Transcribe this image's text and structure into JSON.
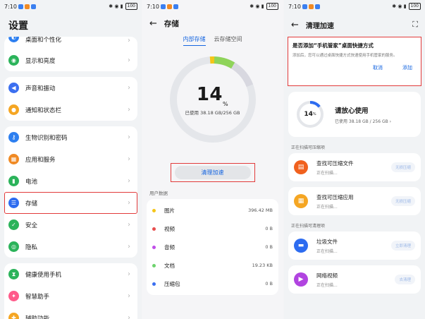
{
  "status": {
    "time": "7:10",
    "battery": "100"
  },
  "settings": {
    "title": "设置",
    "groups": [
      [
        {
          "label": "桌面和个性化",
          "icon": "palette-icon",
          "color": "#2d7ff0"
        },
        {
          "label": "显示和亮度",
          "icon": "eye-icon",
          "color": "#2bb35a"
        }
      ],
      [
        {
          "label": "声音和振动",
          "icon": "speaker-icon",
          "color": "#3b6ff0"
        },
        {
          "label": "通知和状态栏",
          "icon": "bell-icon",
          "color": "#f5a623"
        }
      ],
      [
        {
          "label": "生物识别和密码",
          "icon": "key-icon",
          "color": "#2d7ff0"
        },
        {
          "label": "应用和服务",
          "icon": "apps-icon",
          "color": "#f08a24"
        },
        {
          "label": "电池",
          "icon": "battery-icon",
          "color": "#2bb35a"
        },
        {
          "label": "存储",
          "icon": "storage-icon",
          "color": "#2d6cf0"
        },
        {
          "label": "安全",
          "icon": "shield-icon",
          "color": "#2bb35a"
        },
        {
          "label": "隐私",
          "icon": "privacy-icon",
          "color": "#2bb35a"
        }
      ],
      [
        {
          "label": "健康使用手机",
          "icon": "hourglass-icon",
          "color": "#2bb35a"
        },
        {
          "label": "智慧助手",
          "icon": "assistant-icon",
          "color": "#ff5a8a"
        },
        {
          "label": "辅助功能",
          "icon": "accessibility-icon",
          "color": "#f5a623"
        }
      ]
    ]
  },
  "storage": {
    "title": "存储",
    "tabs": [
      "内部存储",
      "云存储空间"
    ],
    "percent": "14",
    "percent_unit": "%",
    "used_text": "已使用 38.18 GB/256 GB",
    "clean_button": "清理加速",
    "user_data_label": "用户数据",
    "files": [
      {
        "name": "图片",
        "size": "396.42 MB",
        "color": "#f5c518"
      },
      {
        "name": "视频",
        "size": "0 B",
        "color": "#e84e4e"
      },
      {
        "name": "音频",
        "size": "0 B",
        "color": "#c04ee8"
      },
      {
        "name": "文档",
        "size": "19.23 KB",
        "color": "#6dd36d"
      },
      {
        "name": "压缩包",
        "size": "0 B",
        "color": "#3b6ff0"
      }
    ]
  },
  "cleanup": {
    "title": "清理加速",
    "dialog": {
      "title": "是否添加“手机管家”桌面快捷方式",
      "text": "添加后，您可以通过桌面快捷方式快速使用手机管家的服务。",
      "cancel": "取消",
      "confirm": "添加"
    },
    "summary": {
      "percent": "14",
      "unit": "%",
      "title": "请放心使用",
      "subtitle": "已使用 38.18 GB / 256 GB"
    },
    "compress_label": "正在扫描可压缩项",
    "clean_label": "正在扫描可清理项",
    "compress_items": [
      {
        "title": "查找可压缩文件",
        "sub": "正在扫描...",
        "btn": "无损压缩",
        "color": "#f0611e",
        "icon": "file-icon"
      },
      {
        "title": "查找可压缩应用",
        "sub": "正在扫描...",
        "btn": "无损压缩",
        "color": "#f5a623",
        "icon": "apps-icon"
      }
    ],
    "clean_items": [
      {
        "title": "垃圾文件",
        "sub": "正在扫描...",
        "btn": "立即清理",
        "color": "#2d6cf0",
        "icon": "folder-icon"
      },
      {
        "title": "网络视频",
        "sub": "正在扫描...",
        "btn": "去清理",
        "color": "#b144e0",
        "icon": "video-icon"
      }
    ]
  }
}
